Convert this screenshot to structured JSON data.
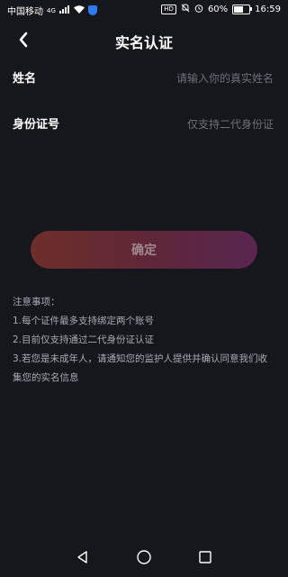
{
  "status_bar": {
    "carrier": "中国移动",
    "network": "4G",
    "hd": "HD",
    "battery": "60%",
    "battery_level": 0.6,
    "time": "16:59"
  },
  "header": {
    "title": "实名认证"
  },
  "form": {
    "name_label": "姓名",
    "name_placeholder": "请输入你的真实姓名",
    "id_label": "身份证号",
    "id_placeholder": "仅支持二代身份证"
  },
  "confirm_label": "确定",
  "notes": {
    "heading": "注意事项：",
    "items": [
      "1.每个证件最多支持绑定两个账号",
      "2.目前仅支持通过二代身份证认证",
      "3.若您是未成年人，请通知您的监护人提供并确认同意我们收集您的实名信息"
    ]
  },
  "colors": {
    "background": "#16161d",
    "button_start": "#6e2e2a",
    "button_end": "#5a2550"
  }
}
